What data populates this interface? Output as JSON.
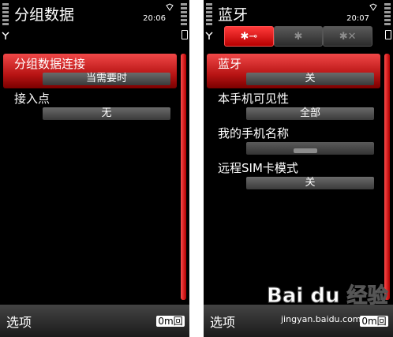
{
  "left_screen": {
    "title": "分组数据",
    "time": "20:06",
    "items": [
      {
        "label": "分组数据连接",
        "value": "当需要时"
      },
      {
        "label": "接入点",
        "value": "无"
      }
    ],
    "softkeys": {
      "left": "选项",
      "right": "0m回"
    }
  },
  "right_screen": {
    "title": "蓝牙",
    "time": "20:07",
    "tabs": [
      {
        "glyph": "✱⊸",
        "icon": "bluetooth-settings-icon"
      },
      {
        "glyph": "✱",
        "icon": "bluetooth-paired-icon"
      },
      {
        "glyph": "✱✕",
        "icon": "bluetooth-blocked-icon"
      }
    ],
    "items": [
      {
        "label": "蓝牙",
        "value": "关"
      },
      {
        "label": "本手机可见性",
        "value": "全部"
      },
      {
        "label": "我的手机名称",
        "value": ""
      },
      {
        "label": "远程SIM卡模式",
        "value": "关"
      }
    ],
    "softkeys": {
      "left": "选项",
      "right": "0m回"
    }
  },
  "watermark": {
    "text": "Bai du 经验",
    "url": "jingyan.baidu.com"
  },
  "colors": {
    "accent": "#d00000",
    "background": "#000000"
  }
}
